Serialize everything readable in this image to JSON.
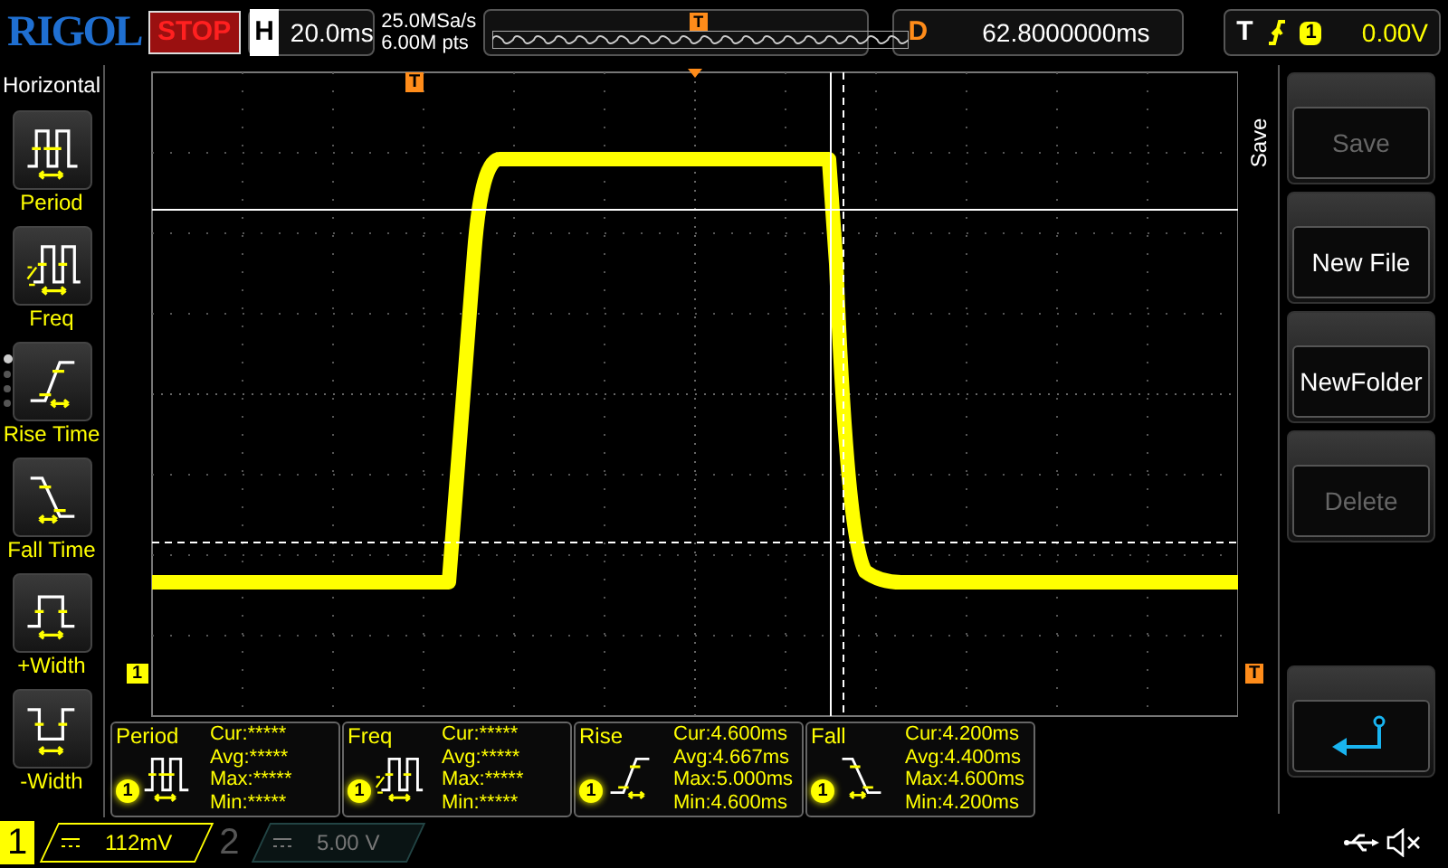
{
  "top_bar": {
    "logo": "RIGOL",
    "run_state": "STOP",
    "timebase_label": "H",
    "timebase": "20.0ms",
    "sample_rate": "25.0MSa/s",
    "memory_depth": "6.00M pts",
    "delay_label": "D",
    "delay": "62.8000000ms",
    "trigger_label": "T",
    "trigger_channel": "1",
    "trigger_level": "0.00V"
  },
  "left_menu": {
    "title": "Horizontal",
    "items": [
      {
        "label": "Period",
        "kind": "period"
      },
      {
        "label": "Freq",
        "kind": "freq"
      },
      {
        "label": "Rise Time",
        "kind": "rise"
      },
      {
        "label": "Fall Time",
        "kind": "fall"
      },
      {
        "label": "+Width",
        "kind": "pwidth"
      },
      {
        "label": "-Width",
        "kind": "nwidth"
      }
    ],
    "page_dots": [
      {
        "selected": true
      },
      {
        "selected": false
      },
      {
        "selected": false
      },
      {
        "selected": false
      }
    ]
  },
  "display": {
    "overview_trigger_marker": "T",
    "trigger_position_marker": "T",
    "channel_marker": "1",
    "trigger_level_marker": "T"
  },
  "measurements": [
    {
      "name": "Period",
      "channel": "1",
      "kind": "period",
      "lines": [
        "Cur:*****",
        "Avg:*****",
        "Max:*****",
        "Min:*****"
      ]
    },
    {
      "name": "Freq",
      "channel": "1",
      "kind": "freq",
      "lines": [
        "Cur:*****",
        "Avg:*****",
        "Max:*****",
        "Min:*****"
      ]
    },
    {
      "name": "Rise",
      "channel": "1",
      "kind": "rise",
      "lines": [
        "Cur:4.600ms",
        "Avg:4.667ms",
        "Max:5.000ms",
        "Min:4.600ms"
      ]
    },
    {
      "name": "Fall",
      "channel": "1",
      "kind": "fall",
      "lines": [
        "Cur:4.200ms",
        "Avg:4.400ms",
        "Max:4.600ms",
        "Min:4.200ms"
      ]
    }
  ],
  "right_menu": {
    "title": "Save",
    "buttons": [
      {
        "kind": "text",
        "label": "Save",
        "disabled": true
      },
      {
        "kind": "text",
        "label": "New File",
        "disabled": false
      },
      {
        "kind": "text",
        "label": "NewFolder",
        "disabled": false
      },
      {
        "kind": "text",
        "label": "Delete",
        "disabled": true
      },
      {
        "kind": "back",
        "disabled": false
      }
    ]
  },
  "bottom_bar": {
    "channels": [
      {
        "number": "1",
        "scale": "112mV",
        "enabled": true
      },
      {
        "number": "2",
        "scale": "5.00 V",
        "enabled": false
      }
    ]
  }
}
